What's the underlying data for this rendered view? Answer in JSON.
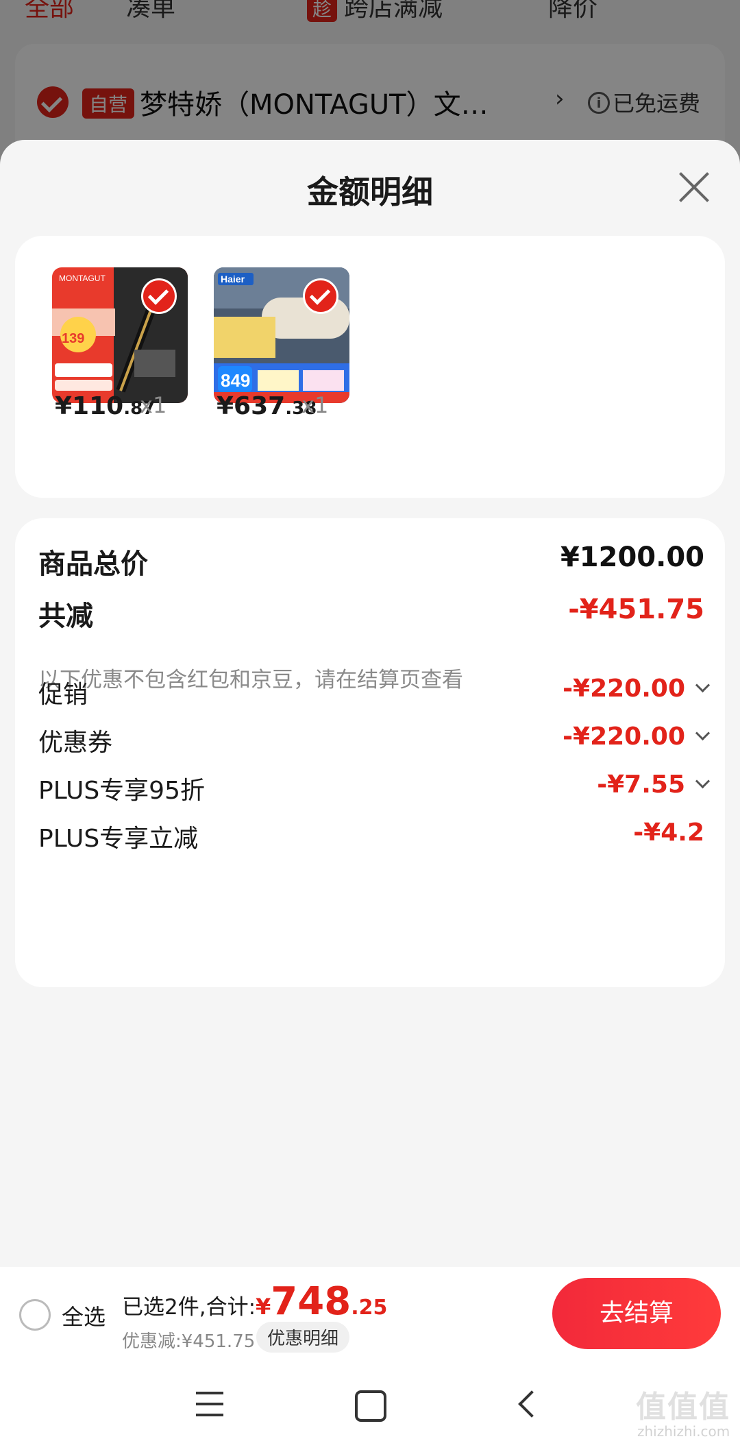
{
  "background": {
    "tabs": [
      "全部",
      "凑单",
      "降价"
    ],
    "promo_tab": {
      "badge": "趁",
      "label": "跨店满减"
    },
    "shop": {
      "self_operated": "自营",
      "name": "梦特娇（MONTAGUT）文…",
      "arrow": "›",
      "shipping": "已免运费"
    }
  },
  "sheet": {
    "title": "金额明细",
    "products": [
      {
        "image": "MONTAGUT pen product image",
        "price_int": "¥110",
        "price_dec": ".87",
        "qty": "x1"
      },
      {
        "image": "Haier water heater product image",
        "price_int": "¥637",
        "price_dec": ".38",
        "qty": "x1"
      }
    ],
    "summary": {
      "total_label": "商品总价",
      "total_value": "¥1200.00",
      "reduce_label": "共减",
      "reduce_value": "-¥451.75",
      "note": "以下优惠不包含红包和京豆，请在结算页查看"
    },
    "breakdown": [
      {
        "label": "促销",
        "value": "-¥220.00",
        "expandable": true
      },
      {
        "label": "优惠券",
        "value": "-¥220.00",
        "expandable": true
      },
      {
        "label": "PLUS专享95折",
        "value": "-¥7.55",
        "expandable": true
      },
      {
        "label": "PLUS专享立减",
        "value": "-¥4.2",
        "expandable": false
      }
    ]
  },
  "checkout": {
    "select_all": "全选",
    "selected_text": "已选2件,合计:",
    "currency": "¥",
    "total_int": "748",
    "total_dec": ".25",
    "discount_text": "优惠减:¥451.75",
    "detail_chip": "优惠明细",
    "button": "去结算"
  },
  "navbar": {
    "watermark": "值值值",
    "watermark_url": "zhizhizhi.com"
  },
  "colors": {
    "accent": "#e2231a",
    "button": "#f2293a"
  }
}
